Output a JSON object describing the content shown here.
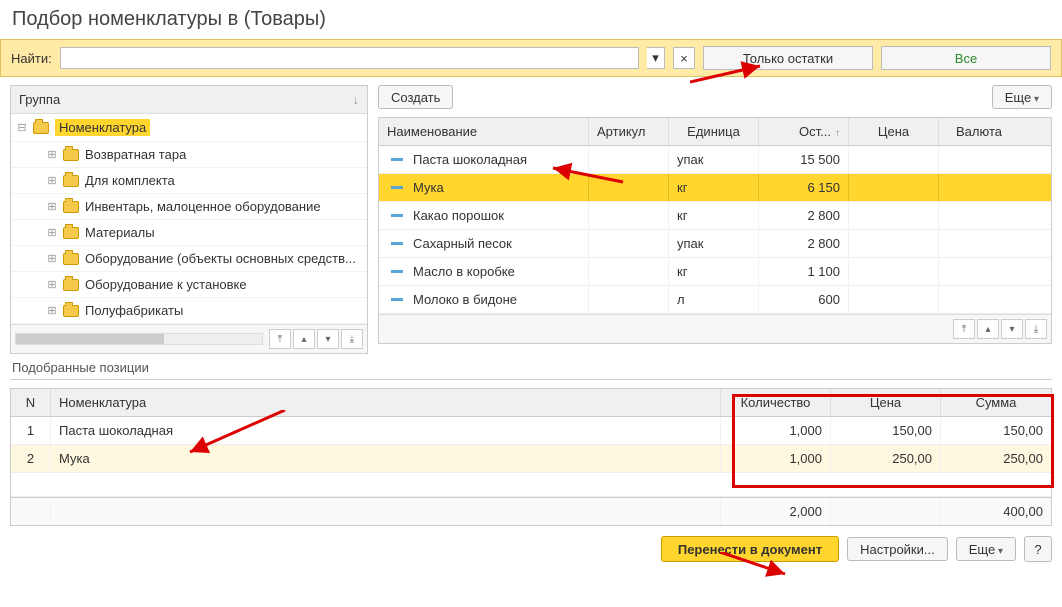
{
  "title": "Подбор номенклатуры в  (Товары)",
  "search": {
    "label": "Найти:",
    "value": ""
  },
  "filters": {
    "stock": "Только остатки",
    "all": "Все"
  },
  "tree": {
    "header": "Группа",
    "root": "Номенклатура",
    "children": [
      "Возвратная тара",
      "Для комплекта",
      "Инвентарь, малоценное оборудование",
      "Материалы",
      "Оборудование (объекты основных средств...",
      "Оборудование к установке",
      "Полуфабрикаты"
    ]
  },
  "toolbar": {
    "create": "Создать",
    "more": "Еще"
  },
  "grid": {
    "headers": {
      "name": "Наименование",
      "article": "Артикул",
      "unit": "Единица",
      "stock": "Ост...",
      "price": "Цена",
      "currency": "Валюта"
    },
    "rows": [
      {
        "name": "Паста шоколадная",
        "article": "",
        "unit": "упак",
        "stock": "15 500",
        "price": "",
        "currency": ""
      },
      {
        "name": "Мука",
        "article": "",
        "unit": "кг",
        "stock": "6 150",
        "price": "",
        "currency": "",
        "selected": true
      },
      {
        "name": "Какао порошок",
        "article": "",
        "unit": "кг",
        "stock": "2 800",
        "price": "",
        "currency": ""
      },
      {
        "name": "Сахарный песок",
        "article": "",
        "unit": "упак",
        "stock": "2 800",
        "price": "",
        "currency": ""
      },
      {
        "name": "Масло в коробке",
        "article": "",
        "unit": "кг",
        "stock": "1 100",
        "price": "",
        "currency": ""
      },
      {
        "name": "Молоко в бидоне",
        "article": "",
        "unit": "л",
        "stock": "600",
        "price": "",
        "currency": ""
      }
    ]
  },
  "selected": {
    "label": "Подобранные позиции",
    "headers": {
      "n": "N",
      "name": "Номенклатура",
      "qty": "Количество",
      "price": "Цена",
      "sum": "Сумма"
    },
    "rows": [
      {
        "n": "1",
        "name": "Паста шоколадная",
        "qty": "1,000",
        "price": "150,00",
        "sum": "150,00"
      },
      {
        "n": "2",
        "name": "Мука",
        "qty": "1,000",
        "price": "250,00",
        "sum": "250,00"
      }
    ],
    "total": {
      "qty": "2,000",
      "sum": "400,00"
    }
  },
  "bottom": {
    "transfer": "Перенести в документ",
    "settings": "Настройки...",
    "more": "Еще",
    "help": "?"
  }
}
